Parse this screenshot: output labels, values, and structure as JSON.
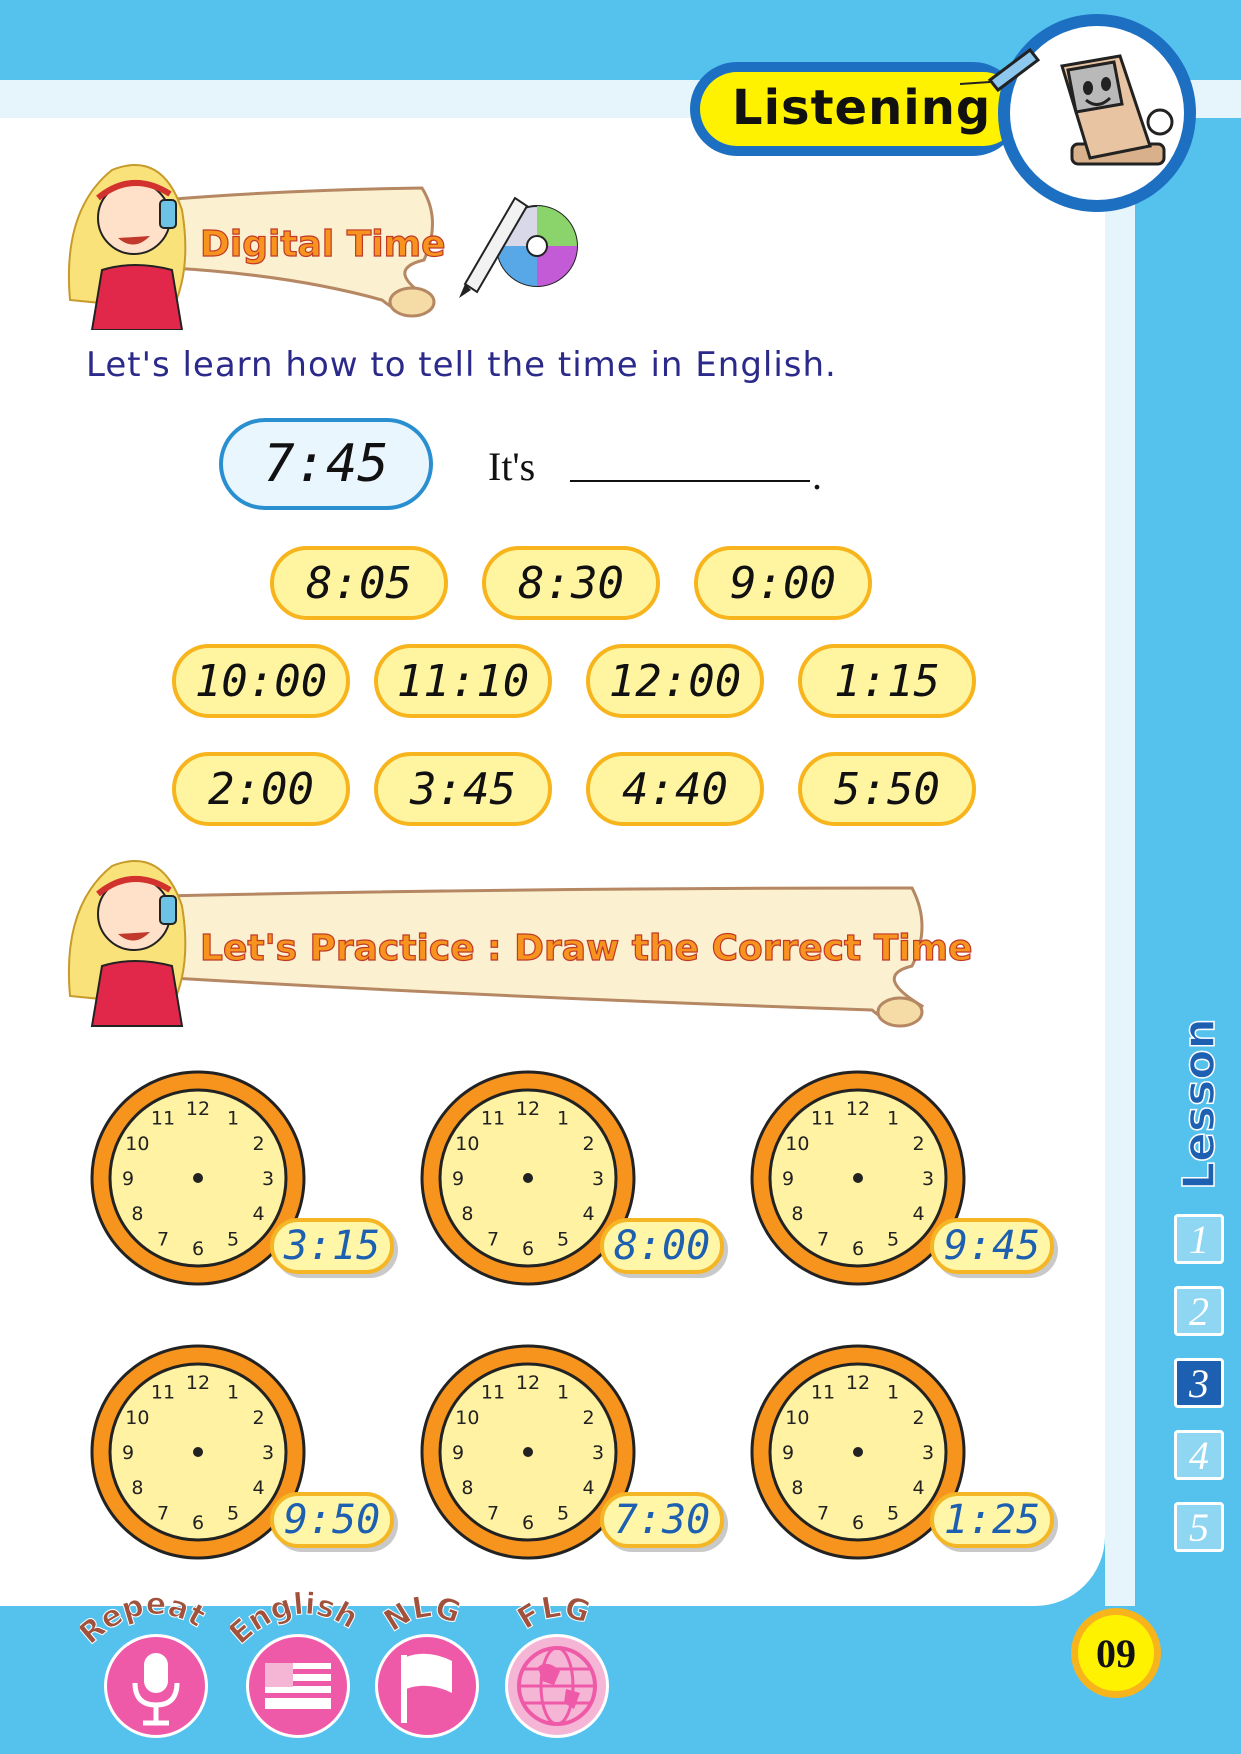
{
  "header": {
    "badge_label": "Listening"
  },
  "section1": {
    "title": "Digital Time",
    "instruction": "Let's learn how to tell the time in English.",
    "example": {
      "time": "7:45",
      "prompt": "It's",
      "end": "."
    },
    "chips": [
      [
        "8:05",
        "8:30",
        "9:00"
      ],
      [
        "10:00",
        "11:10",
        "12:00",
        "1:15"
      ],
      [
        "2:00",
        "3:45",
        "4:40",
        "5:50"
      ]
    ]
  },
  "section2": {
    "title": "Let's Practice : Draw the Correct Time",
    "clocks": [
      "3:15",
      "8:00",
      "9:45",
      "9:50",
      "7:30",
      "1:25"
    ],
    "clock_numbers": [
      "12",
      "1",
      "2",
      "3",
      "4",
      "5",
      "6",
      "7",
      "8",
      "9",
      "10",
      "11"
    ]
  },
  "sidebar": {
    "label": "Lesson",
    "lessons": [
      "1",
      "2",
      "3",
      "4",
      "5"
    ],
    "active_lesson": "3"
  },
  "footer": {
    "labels": [
      "Repeat",
      "English",
      "NLG",
      "FLG"
    ],
    "page_number": "09"
  },
  "colors": {
    "background_blue": "#55c2ee",
    "chip_fill": "#fff5a0",
    "chip_border": "#f7b41d",
    "clock_rim": "#f7941d",
    "instruction_text": "#2b2a8a",
    "footer_pink": "#ee5aa8"
  }
}
